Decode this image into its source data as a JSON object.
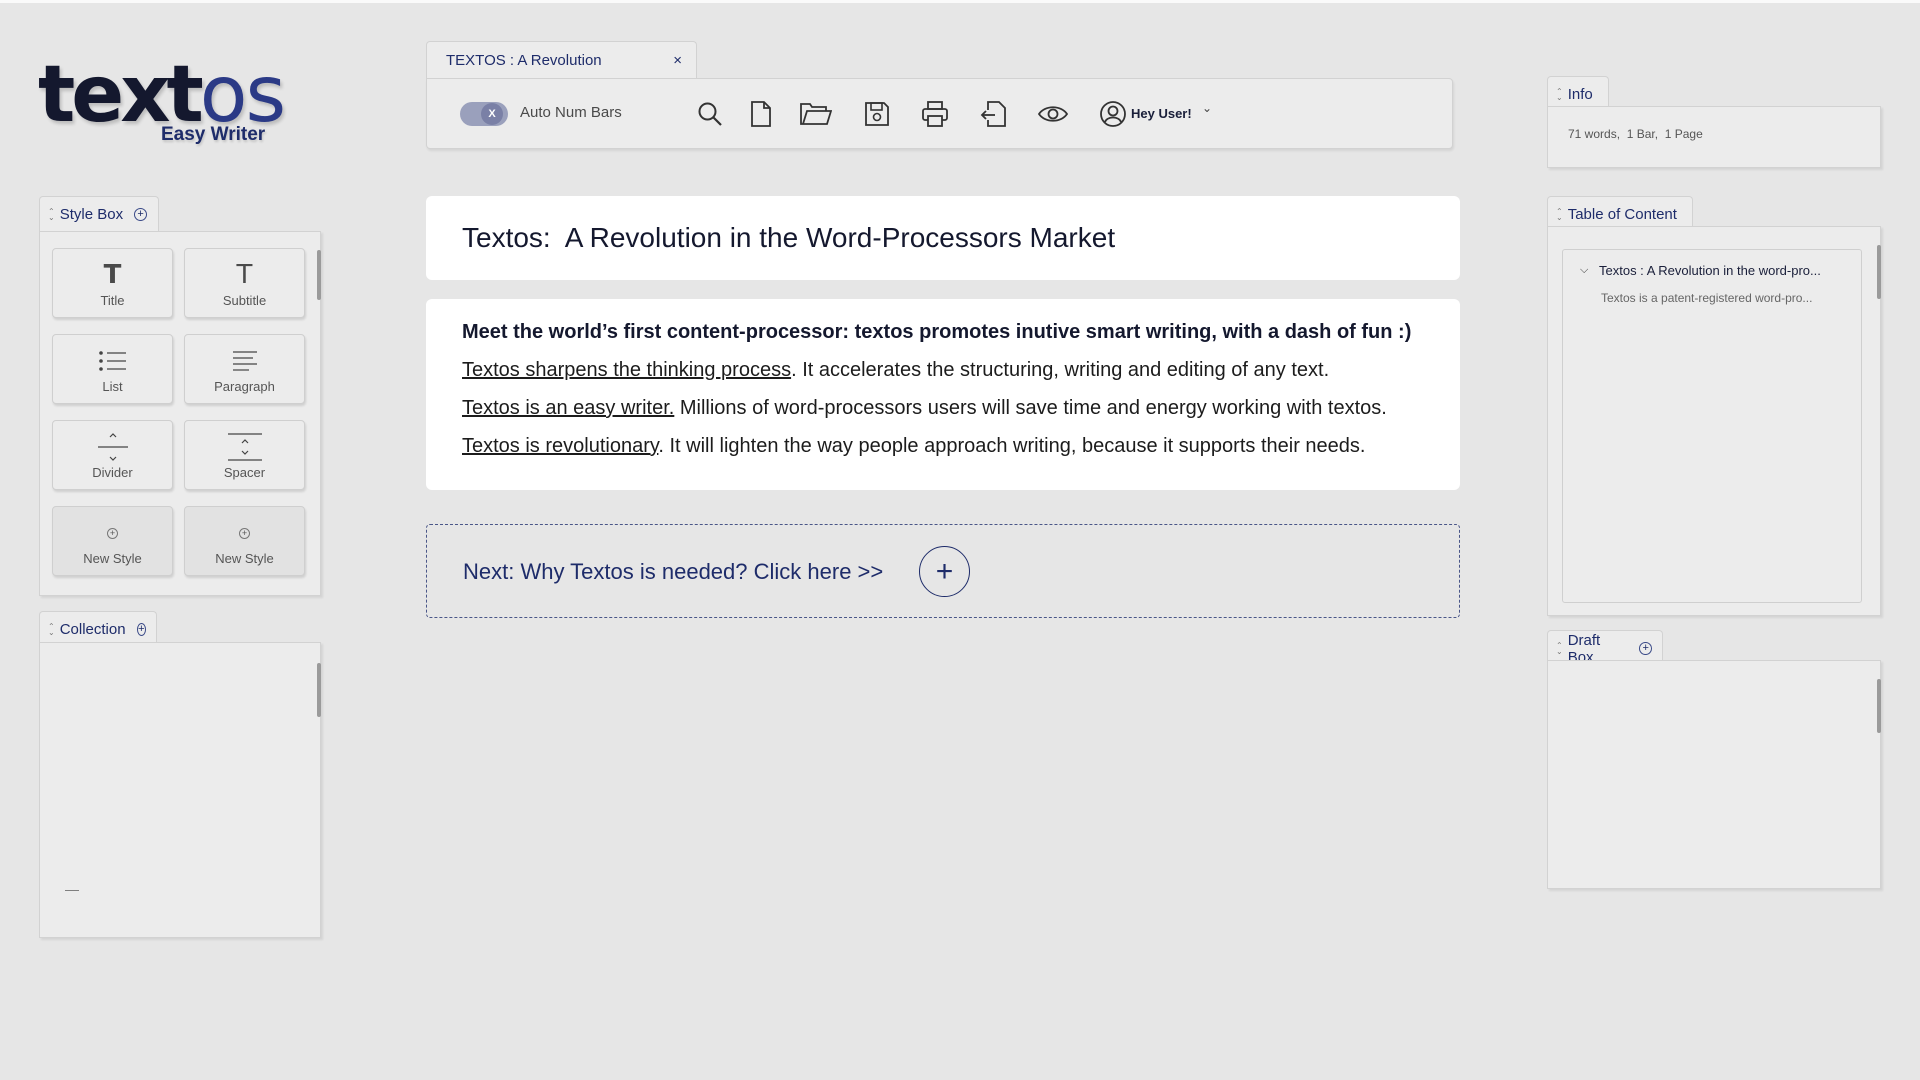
{
  "app": {
    "logo_word_main": "text",
    "logo_word_accent": "os",
    "logo_subtitle": "Easy Writer"
  },
  "style_box": {
    "title": "Style Box",
    "items": [
      {
        "label": "Title",
        "icon": "title-T-icon"
      },
      {
        "label": "Subtitle",
        "icon": "subtitle-T-icon"
      },
      {
        "label": "List",
        "icon": "list-icon"
      },
      {
        "label": "Paragraph",
        "icon": "paragraph-icon"
      },
      {
        "label": "Divider",
        "icon": "divider-icon"
      },
      {
        "label": "Spacer",
        "icon": "spacer-icon"
      },
      {
        "label": "New Style",
        "icon": "plus-icon"
      },
      {
        "label": "New Style",
        "icon": "plus-icon"
      }
    ],
    "title_glyph": "T"
  },
  "collection": {
    "title": "Collection",
    "placeholder_dash": "—"
  },
  "document_tab": {
    "label": "TEXTOS : A Revolution",
    "close": "×"
  },
  "toolbar": {
    "toggle_knob": "X",
    "toggle_label": "Auto Num Bars",
    "user_name": "Hey User!",
    "caret": "⌄",
    "icons": [
      "search-icon",
      "new-file-icon",
      "open-folder-icon",
      "save-icon",
      "print-icon",
      "export-icon",
      "preview-eye-icon",
      "user-icon"
    ]
  },
  "document": {
    "title": "Textos:  A Revolution in the Word-Processors Market",
    "intro": "Meet the world’s first content-processor: textos promotes inutive smart writing, with a dash of fun :)",
    "lines": [
      {
        "link": "Textos sharpens the thinking process",
        "rest": ". It accelerates the structuring, writing and editing of any text."
      },
      {
        "link": "Textos is an easy writer.",
        "rest": " Millions of word-processors users will save time and energy working with textos."
      },
      {
        "link": "Textos is revolutionary",
        "rest": ". It will lighten the way people approach writing, because it supports their needs."
      }
    ],
    "next_text": "Next: Why Textos is needed? Click here >>",
    "next_plus": "+"
  },
  "info": {
    "title": "Info",
    "stats": "71 words,  1 Bar,  1 Page"
  },
  "toc": {
    "title": "Table of Content",
    "caret": "⌵",
    "item_title": "Textos : A Revolution in the word-pro...",
    "item_sub": "Textos is a patent-registered word-pro..."
  },
  "draft_box": {
    "title": "Draft Box"
  },
  "colors": {
    "background": "#e6e6e6",
    "panel": "#ececec",
    "accent_navy": "#1e2c6a",
    "toggle": "#9aa0bc"
  }
}
